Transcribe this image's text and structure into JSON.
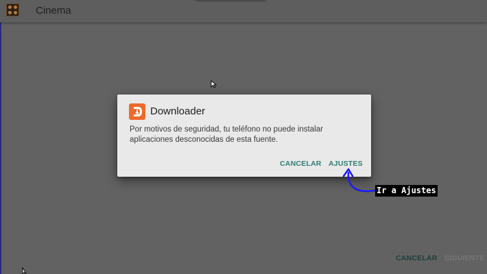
{
  "appbar": {
    "title": "Cinema",
    "icon": "cinema-logo-icon"
  },
  "dialog": {
    "icon": "downloader-logo-icon",
    "title": "Downloader",
    "message": "Por motivos de seguridad, tu teléfono no puede instalar aplicaciones desconocidas de esta fuente.",
    "cancel_label": "CANCELAR",
    "settings_label": "AJUSTES"
  },
  "annotation": {
    "label": "Ir a Ajustes",
    "icon": "curved-arrow-icon",
    "color": "#1a1aff"
  },
  "footer": {
    "cancel_label": "CANCELAR",
    "next_label": "SIGUIENTE"
  },
  "colors": {
    "accent": "#2e7d72",
    "overlay": "#626262",
    "dialog_bg": "#e9e9e9",
    "downloader_orange": "#ee6a2a"
  }
}
